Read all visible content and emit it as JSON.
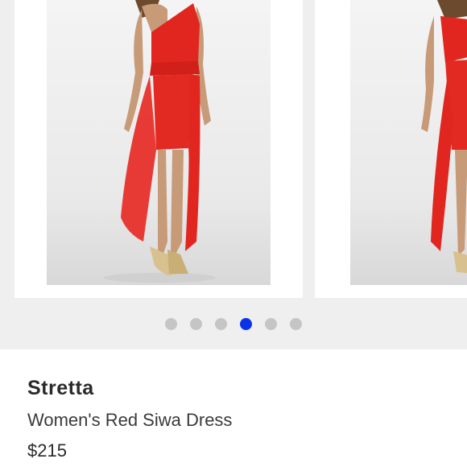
{
  "listing": {
    "brand": "Stretta",
    "title": "Women's Red Siwa Dress",
    "price": "$215"
  },
  "carousel": {
    "slide_count": 6,
    "active_index": 3,
    "slides": [
      {
        "image": "red one-shoulder high-low dress, front view"
      },
      {
        "image": "red one-shoulder high-low dress, side view"
      }
    ]
  },
  "colors": {
    "accent_dot": "#0a33e8",
    "inactive_dot": "#c5c5c5",
    "dress_red": "#e0261f",
    "carousel_bg": "#efefef"
  }
}
